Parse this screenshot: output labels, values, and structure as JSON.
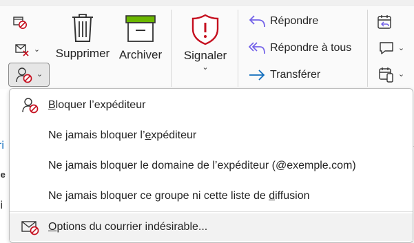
{
  "ribbon": {
    "delete_label": "Supprimer",
    "archive_label": "Archiver",
    "report_label": "Signaler",
    "reply_label": "Répondre",
    "reply_all_label": "Répondre à tous",
    "forward_label": "Transférer"
  },
  "background": {
    "fragment_1": "ri",
    "fragment_2": "ie",
    "fragment_3": "li"
  },
  "menu": {
    "block_sender": {
      "key": "B",
      "rest": "loquer l’expéditeur"
    },
    "never_block_sender": {
      "before": "Ne jamais bloquer l’",
      "key": "e",
      "after": "xpéditeur"
    },
    "never_block_domain": "Ne jamais bloquer le domaine de l’expéditeur (@exemple.com)",
    "never_block_group": {
      "before": "Ne jamais bloquer ce groupe ni cette liste de ",
      "key": "d",
      "after": "iffusion"
    },
    "junk_options": {
      "key": "O",
      "rest": "ptions du courrier indésirable..."
    }
  },
  "colors": {
    "accent_purple": "#7160e8",
    "accent_blue": "#0f6cbd",
    "danger_red": "#c50f1f",
    "archive_green": "#6bb700"
  }
}
